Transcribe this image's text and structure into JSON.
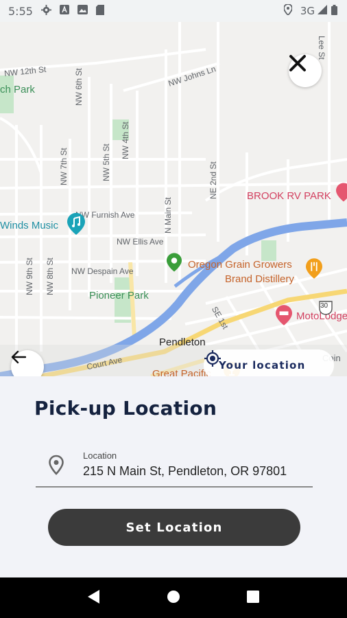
{
  "status_bar": {
    "time": "5:55",
    "network": "3G",
    "icons_left": [
      "settings-icon",
      "a-icon",
      "image-icon",
      "sd-card-icon"
    ],
    "icons_right": [
      "location-icon",
      "signal-icon",
      "battery-icon"
    ]
  },
  "map": {
    "streets": [
      "NW 12th St",
      "NW Johns Ln",
      "NW 6th St",
      "NW 4th St",
      "NW 5th St",
      "NW 7th St",
      "NE 2nd St",
      "NW Furnish Ave",
      "N Main St",
      "NW Ellis Ave",
      "NW Despain Ave",
      "NW 9th St",
      "NW 8th St",
      "SE 1st",
      "Court Ave",
      "Lee St"
    ],
    "places": {
      "park_partial": "ch Park",
      "winds_music": "Winds Music",
      "brook_rv": "BROOK RV PARK",
      "oregon_grain_1": "Oregon Grain Growers",
      "oregon_grain_2": "Brand Distillery",
      "pioneer_park": "Pioneer Park",
      "motolodge": "MotoLodge",
      "pendleton": "Pendleton",
      "great_pacific": "Great Pacific",
      "coin": "Coin",
      "shield": "30"
    },
    "your_location_label": "Your location"
  },
  "sheet": {
    "title": "Pick-up Location",
    "field_caption": "Location",
    "field_value": "215 N Main St, Pendleton, OR 97801",
    "set_button": "Set Location"
  },
  "colors": {
    "title": "#15223f",
    "button_bg": "#3b3b3b",
    "river": "#7fa6e8",
    "highway": "#f7d774",
    "park": "#c6e6c9"
  }
}
